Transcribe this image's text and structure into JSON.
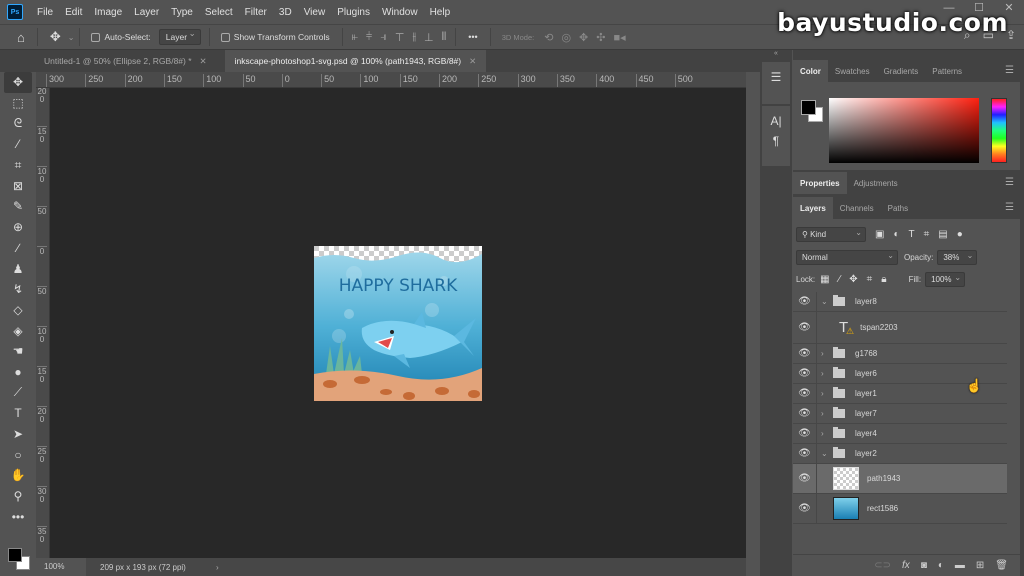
{
  "app": {
    "logo": "Ps",
    "watermark": "bayustudio.com"
  },
  "menu": [
    "File",
    "Edit",
    "Image",
    "Layer",
    "Type",
    "Select",
    "Filter",
    "3D",
    "View",
    "Plugins",
    "Window",
    "Help"
  ],
  "window_controls": {
    "minimize": "—",
    "maximize": "☐",
    "close": "✕"
  },
  "options_bar": {
    "home_icon": "⌂",
    "move_icon": "✥",
    "auto_select_label": "Auto-Select:",
    "auto_select_checked": false,
    "layer_select_value": "Layer",
    "show_transform_label": "Show Transform Controls",
    "show_transform_checked": false,
    "more_icon": "•••",
    "mode_3d_label": "3D Mode:",
    "search_icon": "⌕",
    "workspace_icon": "▭",
    "share_icon": "⇪"
  },
  "tabs": [
    {
      "label": "Untitled-1 @ 50% (Ellipse 2, RGB/8#) *",
      "active": false
    },
    {
      "label": "inkscape-photoshop1-svg.psd @ 100% (path1943, RGB/8#)",
      "active": true
    }
  ],
  "ruler_h": [
    "300",
    "250",
    "200",
    "150",
    "100",
    "50",
    "0",
    "50",
    "100",
    "150",
    "200",
    "250",
    "300",
    "350",
    "400",
    "450",
    "500"
  ],
  "ruler_v": [
    "200",
    "150",
    "100",
    "50",
    "0",
    "50",
    "100",
    "150",
    "200",
    "250",
    "300",
    "350"
  ],
  "tools": [
    {
      "name": "move-tool",
      "glyph": "✥",
      "active": true
    },
    {
      "name": "marquee-tool",
      "glyph": "⬚"
    },
    {
      "name": "lasso-tool",
      "glyph": "ᘓ"
    },
    {
      "name": "magic-wand-tool",
      "glyph": "⁄"
    },
    {
      "name": "crop-tool",
      "glyph": "⌗"
    },
    {
      "name": "frame-tool",
      "glyph": "⊠"
    },
    {
      "name": "eyedropper-tool",
      "glyph": "✎"
    },
    {
      "name": "healing-brush-tool",
      "glyph": "⊕"
    },
    {
      "name": "brush-tool",
      "glyph": "∕"
    },
    {
      "name": "clone-stamp-tool",
      "glyph": "♟"
    },
    {
      "name": "history-brush-tool",
      "glyph": "↯"
    },
    {
      "name": "eraser-tool",
      "glyph": "◇"
    },
    {
      "name": "paint-bucket-tool",
      "glyph": "◈"
    },
    {
      "name": "smudge-tool",
      "glyph": "☚"
    },
    {
      "name": "dodge-tool",
      "glyph": "●"
    },
    {
      "name": "pen-tool",
      "glyph": "⟋"
    },
    {
      "name": "type-tool",
      "glyph": "T"
    },
    {
      "name": "path-selection-tool",
      "glyph": "➤"
    },
    {
      "name": "ellipse-tool",
      "glyph": "○"
    },
    {
      "name": "hand-tool",
      "glyph": "✋"
    },
    {
      "name": "zoom-tool",
      "glyph": "⚲"
    },
    {
      "name": "edit-toolbar",
      "glyph": "•••"
    }
  ],
  "status": {
    "zoom": "100%",
    "doc_info": "209 px x 193 px (72 ppi)",
    "arrow": "›"
  },
  "minidock": {
    "history_icon": "☰",
    "character_icon": "A|",
    "paragraph_icon": "¶"
  },
  "artwork": {
    "title": "HAPPY SHARK"
  },
  "color_panel": {
    "tabs": [
      "Color",
      "Swatches",
      "Gradients",
      "Patterns"
    ],
    "foreground": "#000000",
    "background": "#ffffff"
  },
  "properties_panel": {
    "tabs": [
      "Properties",
      "Adjustments"
    ]
  },
  "layers_panel": {
    "tabs": [
      "Layers",
      "Channels",
      "Paths"
    ],
    "filter_kind": "Kind",
    "blend_mode": "Normal",
    "opacity_label": "Opacity:",
    "opacity_value": "38%",
    "lock_label": "Lock:",
    "fill_label": "Fill:",
    "fill_value": "100%",
    "layers": [
      {
        "name": "layer8",
        "type": "group",
        "expanded": true,
        "indent": 0
      },
      {
        "name": "tspan2203",
        "type": "text",
        "warning": true,
        "indent": 1
      },
      {
        "name": "g1768",
        "type": "group",
        "expanded": false,
        "indent": 0
      },
      {
        "name": "layer6",
        "type": "group",
        "expanded": false,
        "indent": 0
      },
      {
        "name": "layer1",
        "type": "group",
        "expanded": false,
        "indent": 0
      },
      {
        "name": "layer7",
        "type": "group",
        "expanded": false,
        "indent": 0
      },
      {
        "name": "layer4",
        "type": "group",
        "expanded": false,
        "indent": 0
      },
      {
        "name": "layer2",
        "type": "group",
        "expanded": true,
        "indent": 0
      },
      {
        "name": "path1943",
        "type": "smart",
        "selected": true,
        "indent": 1
      },
      {
        "name": "rect1586",
        "type": "smart",
        "indent": 1
      }
    ],
    "footer_icons": [
      "link",
      "fx",
      "mask",
      "adjustment",
      "group",
      "new-layer",
      "delete"
    ]
  }
}
